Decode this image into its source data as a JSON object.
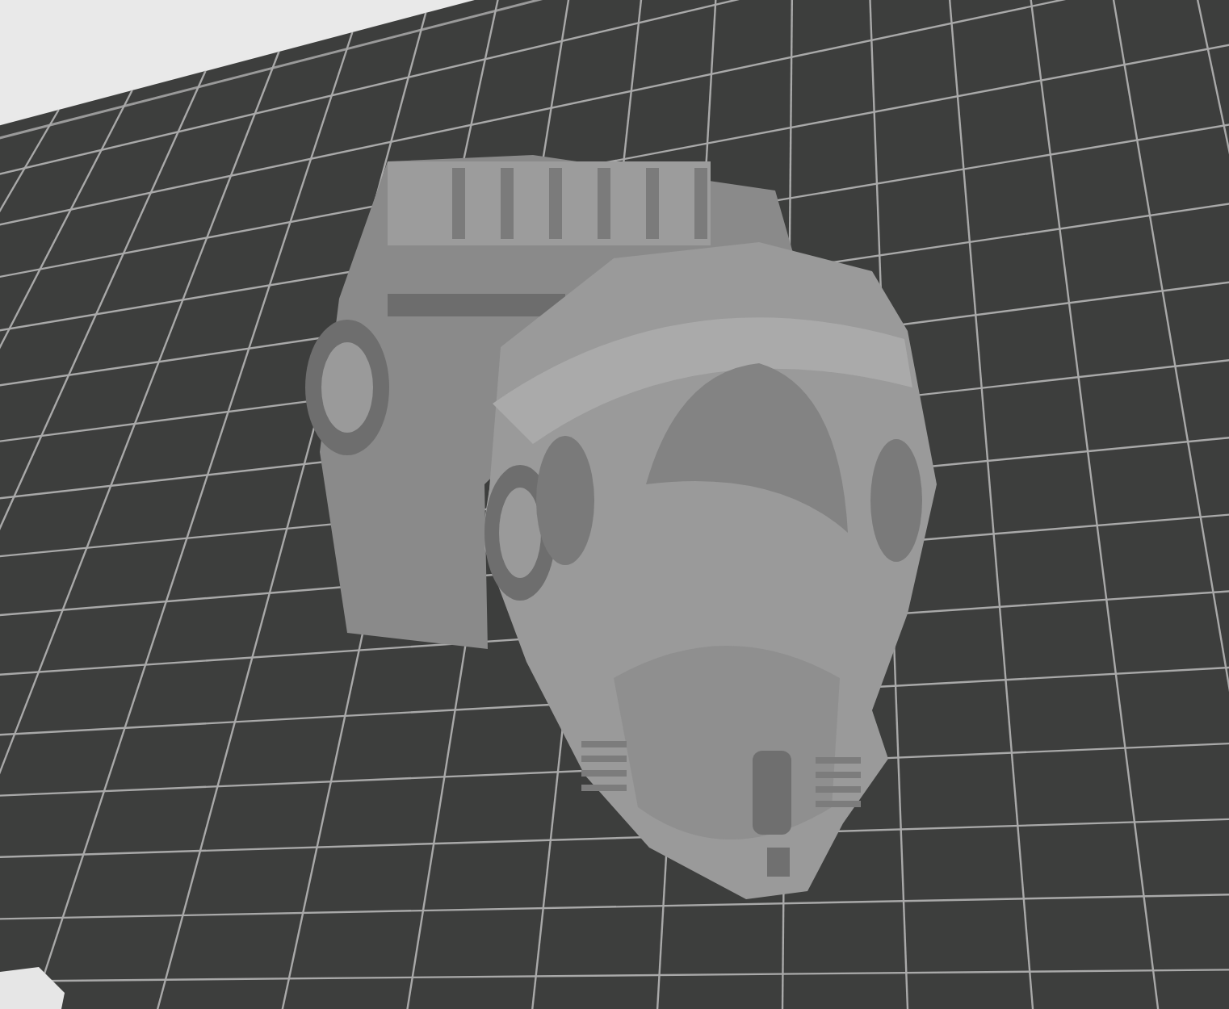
{
  "viewport": {
    "kind": "build-plate",
    "model": {
      "kind": "car-body"
    }
  }
}
